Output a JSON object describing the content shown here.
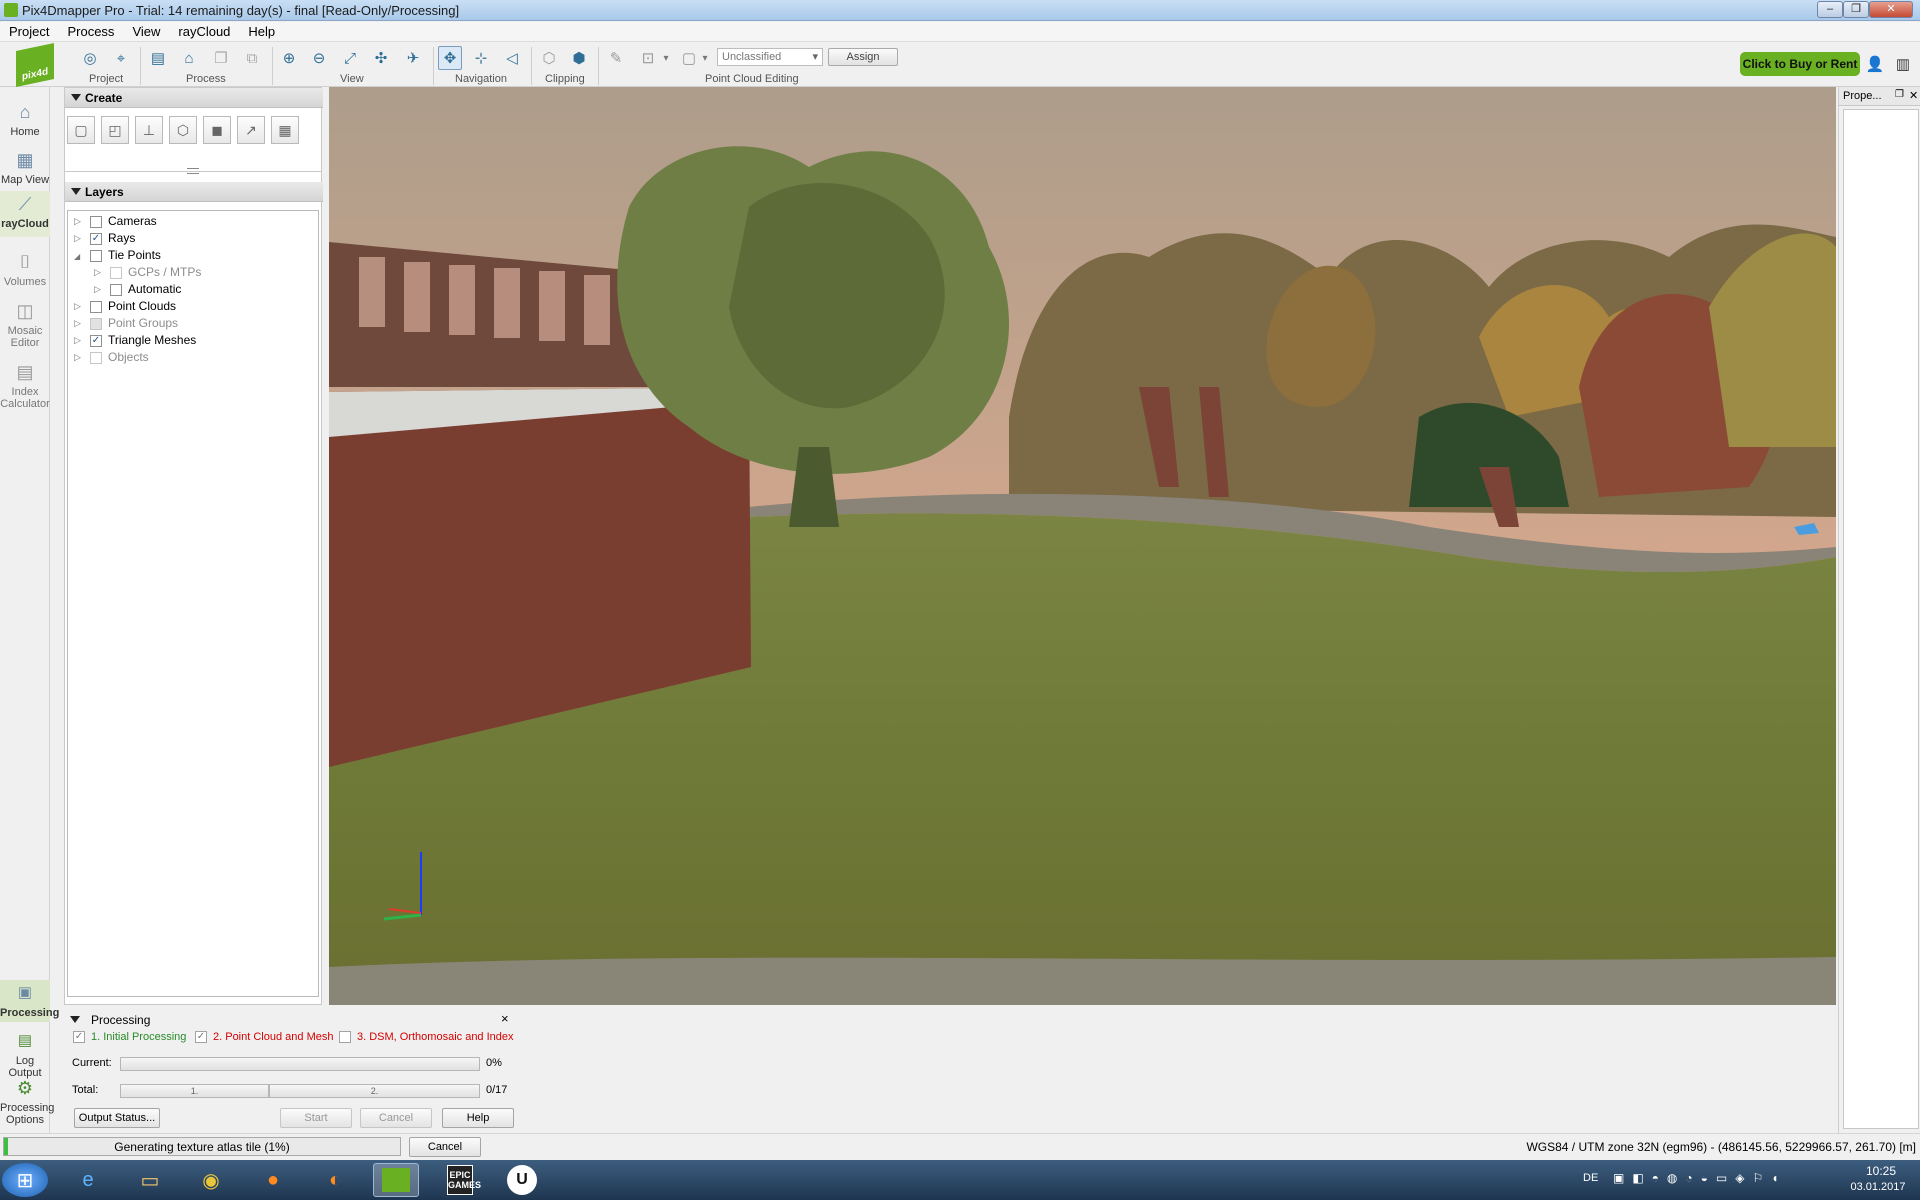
{
  "window": {
    "title": "Pix4Dmapper Pro - Trial: 14 remaining day(s) - final [Read-Only/Processing]",
    "minimize": "–",
    "maximize": "❐",
    "close": "✕"
  },
  "menu": [
    "Project",
    "Process",
    "View",
    "rayCloud",
    "Help"
  ],
  "toolbar": {
    "groups": [
      "Project",
      "Process",
      "View",
      "Navigation",
      "Clipping",
      "Point Cloud Editing"
    ],
    "class_select": "Unclassified",
    "assign": "Assign",
    "buy_rent": "Click to Buy or Rent",
    "logo_text": "pix4d"
  },
  "sidenav": {
    "home": "Home",
    "map_view": "Map View",
    "raycloud": "rayCloud",
    "volumes": "Volumes",
    "mosaic_editor": "Mosaic Editor",
    "index_calculator": "Index Calculator",
    "processing": "Processing",
    "log_output": "Log Output",
    "processing_options": "Processing Options"
  },
  "left_panel": {
    "create": "Create",
    "layers": "Layers",
    "tree": [
      {
        "label": "Cameras",
        "checked": false
      },
      {
        "label": "Rays",
        "checked": true
      },
      {
        "label": "Tie Points",
        "checked": false
      },
      {
        "label": "GCPs / MTPs",
        "checked": false
      },
      {
        "label": "Automatic",
        "checked": false
      },
      {
        "label": "Point Clouds",
        "checked": false
      },
      {
        "label": "Point Groups",
        "checked": false
      },
      {
        "label": "Triangle Meshes",
        "checked": true
      },
      {
        "label": "Objects",
        "checked": false
      }
    ],
    "check_mark": "✓"
  },
  "properties": {
    "title": "Prope..."
  },
  "processing": {
    "title": "Processing",
    "close": "×",
    "steps": [
      {
        "label": "1. Initial Processing",
        "checked": true
      },
      {
        "label": "2. Point Cloud and Mesh",
        "checked": true
      },
      {
        "label": "3. DSM, Orthomosaic and Index",
        "checked": false
      }
    ],
    "current_label": "Current:",
    "current_value": "0%",
    "current_progress": 0,
    "total_label": "Total:",
    "total_value": "0/17",
    "total_seg1": "1.",
    "total_seg2": "2.",
    "output_status": "Output Status...",
    "start": "Start",
    "cancel": "Cancel",
    "help": "Help"
  },
  "status": {
    "task": "Generating texture atlas tile (1%)",
    "task_progress": 1,
    "cancel": "Cancel",
    "coords": "WGS84 / UTM zone 32N (egm96) - (486145.56, 5229966.57, 261.70) [m]"
  },
  "taskbar": {
    "lang": "DE",
    "time": "10:25",
    "date": "03.01.2017",
    "epic_label": "EPIC GAMES"
  }
}
